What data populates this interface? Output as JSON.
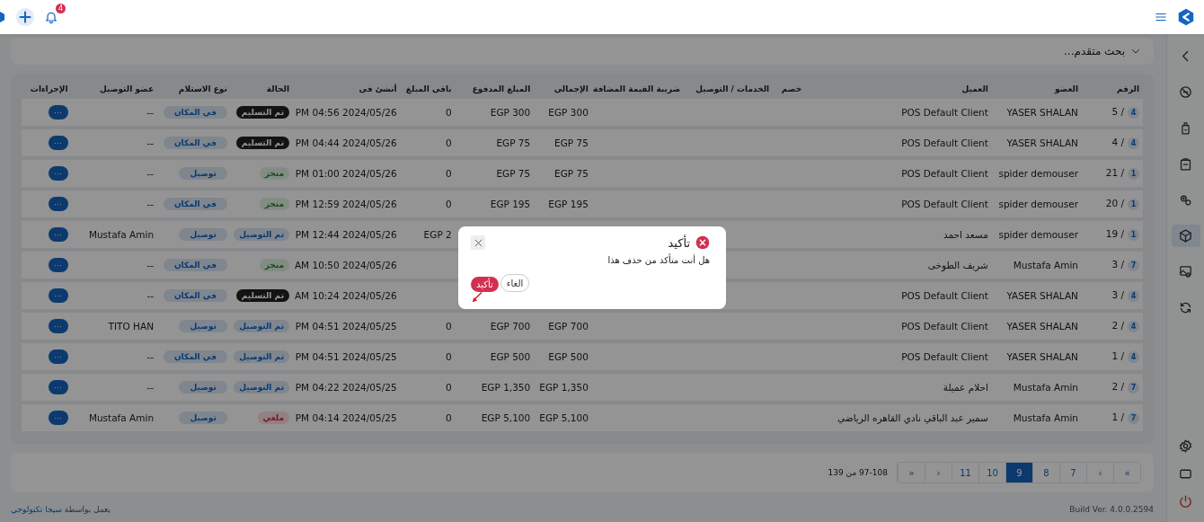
{
  "topbar": {
    "notification_count": "4"
  },
  "sidebar": {
    "items": [
      {
        "kind": "back",
        "selected": false
      },
      {
        "kind": "blocked",
        "selected": false
      },
      {
        "kind": "device",
        "selected": false
      },
      {
        "kind": "clipboard",
        "selected": false
      },
      {
        "kind": "gears",
        "selected": false
      },
      {
        "kind": "box",
        "selected": true
      },
      {
        "kind": "photo",
        "selected": false
      },
      {
        "kind": "refresh",
        "selected": false
      }
    ],
    "bottom_items": [
      {
        "kind": "settings"
      },
      {
        "kind": "screen"
      },
      {
        "kind": "power"
      }
    ]
  },
  "advanced_search": {
    "label": "بحث متقدم..."
  },
  "table": {
    "columns": [
      "الرقم",
      "العضو",
      "العميل",
      "خصم",
      "الخدمات / التوصيل",
      "ضريبة القيمة المضافة",
      "الإجمالى",
      "المبلغ المدفوع",
      "باقى المبلغ",
      "أنشئ فى",
      "الحالة",
      "نوع الاستلام",
      "عضو التوصيل",
      "الإجراءات"
    ],
    "rows": [
      {
        "badge": "4",
        "number": "5 /",
        "member": "YASER SHALAN",
        "client": "POS Default Client",
        "total": "EGP 300",
        "paid": "EGP 300",
        "remaining": "0",
        "created": "PM 04:56 2024/05/26",
        "status": {
          "label": "تم التسليم",
          "kind": "handed"
        },
        "pickup": "في المكان",
        "courier": "--",
        "action": "···"
      },
      {
        "badge": "4",
        "number": "4 /",
        "member": "YASER SHALAN",
        "client": "POS Default Client",
        "total": "EGP 75",
        "paid": "EGP 75",
        "remaining": "0",
        "created": "PM 04:44 2024/05/26",
        "status": {
          "label": "تم التسليم",
          "kind": "handed"
        },
        "pickup": "في المكان",
        "courier": "--",
        "action": "···"
      },
      {
        "badge": "1",
        "number": "21 /",
        "member": "spider demouser",
        "client": "POS Default Client",
        "total": "EGP 75",
        "paid": "EGP 75",
        "remaining": "0",
        "created": "PM 01:00 2024/05/26",
        "status": {
          "label": "منجز",
          "kind": "done"
        },
        "pickup": "توصيل",
        "courier": "--",
        "action": "···"
      },
      {
        "badge": "1",
        "number": "20 /",
        "member": "spider demouser",
        "client": "POS Default Client",
        "total": "EGP 195",
        "paid": "EGP 195",
        "remaining": "0",
        "created": "PM 12:59 2024/05/26",
        "status": {
          "label": "منجز",
          "kind": "done"
        },
        "pickup": "في المكان",
        "courier": "--",
        "action": "···"
      },
      {
        "badge": "1",
        "number": "19 /",
        "member": "spider demouser",
        "client": "مسعد احمد",
        "remaining": "EGP 2",
        "created": "PM 12:44 2024/05/26",
        "status": {
          "label": "تم التوصيل",
          "kind": "delivered"
        },
        "pickup": "توصيل",
        "courier": "Mustafa Amin",
        "action": "···"
      },
      {
        "badge": "7",
        "number": "3 /",
        "member": "Mustafa Amin",
        "client": "شريف الطوخى",
        "created": "AM 10:50 2024/05/26",
        "status": {
          "label": "منجز",
          "kind": "done"
        },
        "pickup": "في المكان",
        "courier": "--",
        "action": "···"
      },
      {
        "badge": "4",
        "number": "3 /",
        "member": "YASER SHALAN",
        "client": "POS Default Client",
        "created": "AM 10:24 2024/05/26",
        "status": {
          "label": "تم التسليم",
          "kind": "handed"
        },
        "pickup": "في المكان",
        "courier": "--",
        "action": "···"
      },
      {
        "badge": "4",
        "number": "2 /",
        "member": "YASER SHALAN",
        "client": "POS Default Client",
        "total": "EGP 700",
        "paid": "EGP 700",
        "remaining": "0",
        "created": "PM 04:51 2024/05/25",
        "status": {
          "label": "تم التوصيل",
          "kind": "delivered"
        },
        "pickup": "توصيل",
        "courier": "TITO HAN",
        "action": "···"
      },
      {
        "badge": "4",
        "number": "1 /",
        "member": "YASER SHALAN",
        "client": "POS Default Client",
        "total": "EGP 500",
        "paid": "EGP 500",
        "remaining": "0",
        "created": "PM 04:51 2024/05/25",
        "status": {
          "label": "تم التوصيل",
          "kind": "delivered"
        },
        "pickup": "في المكان",
        "courier": "--",
        "action": "···"
      },
      {
        "badge": "7",
        "number": "2 /",
        "member": "Mustafa Amin",
        "client": "احلام عميلة",
        "total": "EGP 1,350",
        "paid": "EGP 1,350",
        "remaining": "0",
        "created": "PM 04:22 2024/05/25",
        "status": {
          "label": "تم التوصيل",
          "kind": "delivered"
        },
        "pickup": "توصيل",
        "courier": "--",
        "action": "···"
      },
      {
        "badge": "7",
        "number": "1 /",
        "member": "Mustafa Amin",
        "client": "سمير عبد الباقي نادي القاهره الرياضي",
        "total": "EGP 5,100",
        "paid": "EGP 5,100",
        "remaining": "0",
        "created": "PM 04:14 2024/05/25",
        "status": {
          "label": "ملغي",
          "kind": "cancelled"
        },
        "pickup": "توصيل",
        "courier": "Mustafa Amin",
        "action": "···"
      }
    ]
  },
  "pagination": {
    "pages": [
      {
        "label": "»",
        "selected": false
      },
      {
        "label": "›",
        "selected": false
      },
      {
        "label": "7",
        "selected": false
      },
      {
        "label": "8",
        "selected": false
      },
      {
        "label": "9",
        "selected": true
      },
      {
        "label": "10",
        "selected": false
      },
      {
        "label": "11",
        "selected": false
      },
      {
        "label": "‹",
        "selected": false
      },
      {
        "label": "«",
        "selected": false
      }
    ],
    "range": "97-108 من 139"
  },
  "footer": {
    "powered_by": "يعمل بواسطة",
    "company": "سيجا تكنولوجي",
    "build": "Build Ver. 4.0.0.2594"
  },
  "dialog": {
    "title": "تأكيد",
    "message": "هل أنت متأكد من حذف هذا",
    "cancel": "الغاء",
    "confirm": "تأكيد"
  }
}
